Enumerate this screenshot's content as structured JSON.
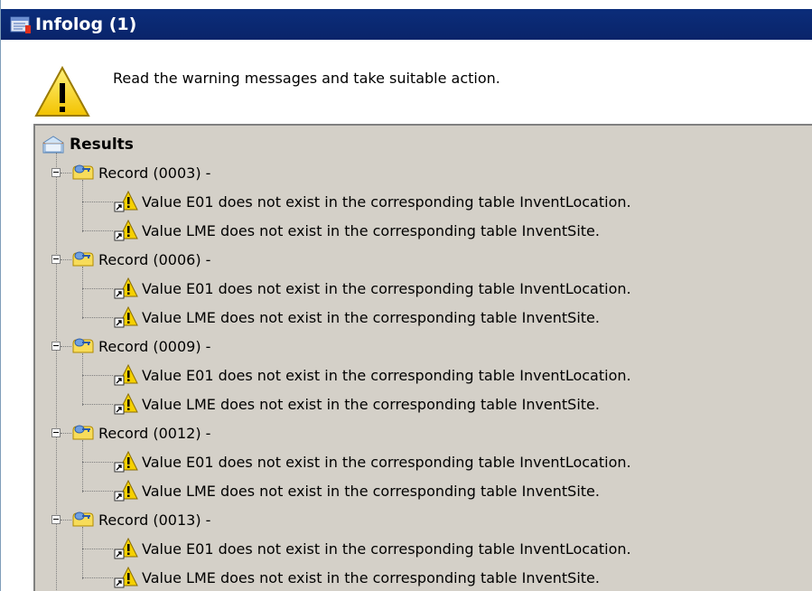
{
  "window": {
    "title": "Infolog (1)"
  },
  "header": {
    "message": "Read the warning messages and take suitable action."
  },
  "results": {
    "label": "Results",
    "records": [
      {
        "label": "Record (0003) -",
        "messages": [
          "Value E01 does not exist in the corresponding table InventLocation.",
          "Value LME does not exist in the corresponding table InventSite."
        ]
      },
      {
        "label": "Record (0006) -",
        "messages": [
          "Value E01 does not exist in the corresponding table InventLocation.",
          "Value LME does not exist in the corresponding table InventSite."
        ]
      },
      {
        "label": "Record (0009) -",
        "messages": [
          "Value E01 does not exist in the corresponding table InventLocation.",
          "Value LME does not exist in the corresponding table InventSite."
        ]
      },
      {
        "label": "Record (0012) -",
        "messages": [
          "Value E01 does not exist in the corresponding table InventLocation.",
          "Value LME does not exist in the corresponding table InventSite."
        ]
      },
      {
        "label": "Record (0013) -",
        "messages": [
          "Value E01 does not exist in the corresponding table InventLocation.",
          "Value LME does not exist in the corresponding table InventSite."
        ]
      }
    ]
  },
  "icons": {
    "title": "infolog-icon",
    "header": "warning-icon",
    "results": "results-folder-icon",
    "record": "record-key-icon",
    "message": "warning-shortcut-icon"
  },
  "colors": {
    "titlebar": "#0a246a",
    "panel": "#d4d0c8",
    "warning": "#f5d000"
  }
}
